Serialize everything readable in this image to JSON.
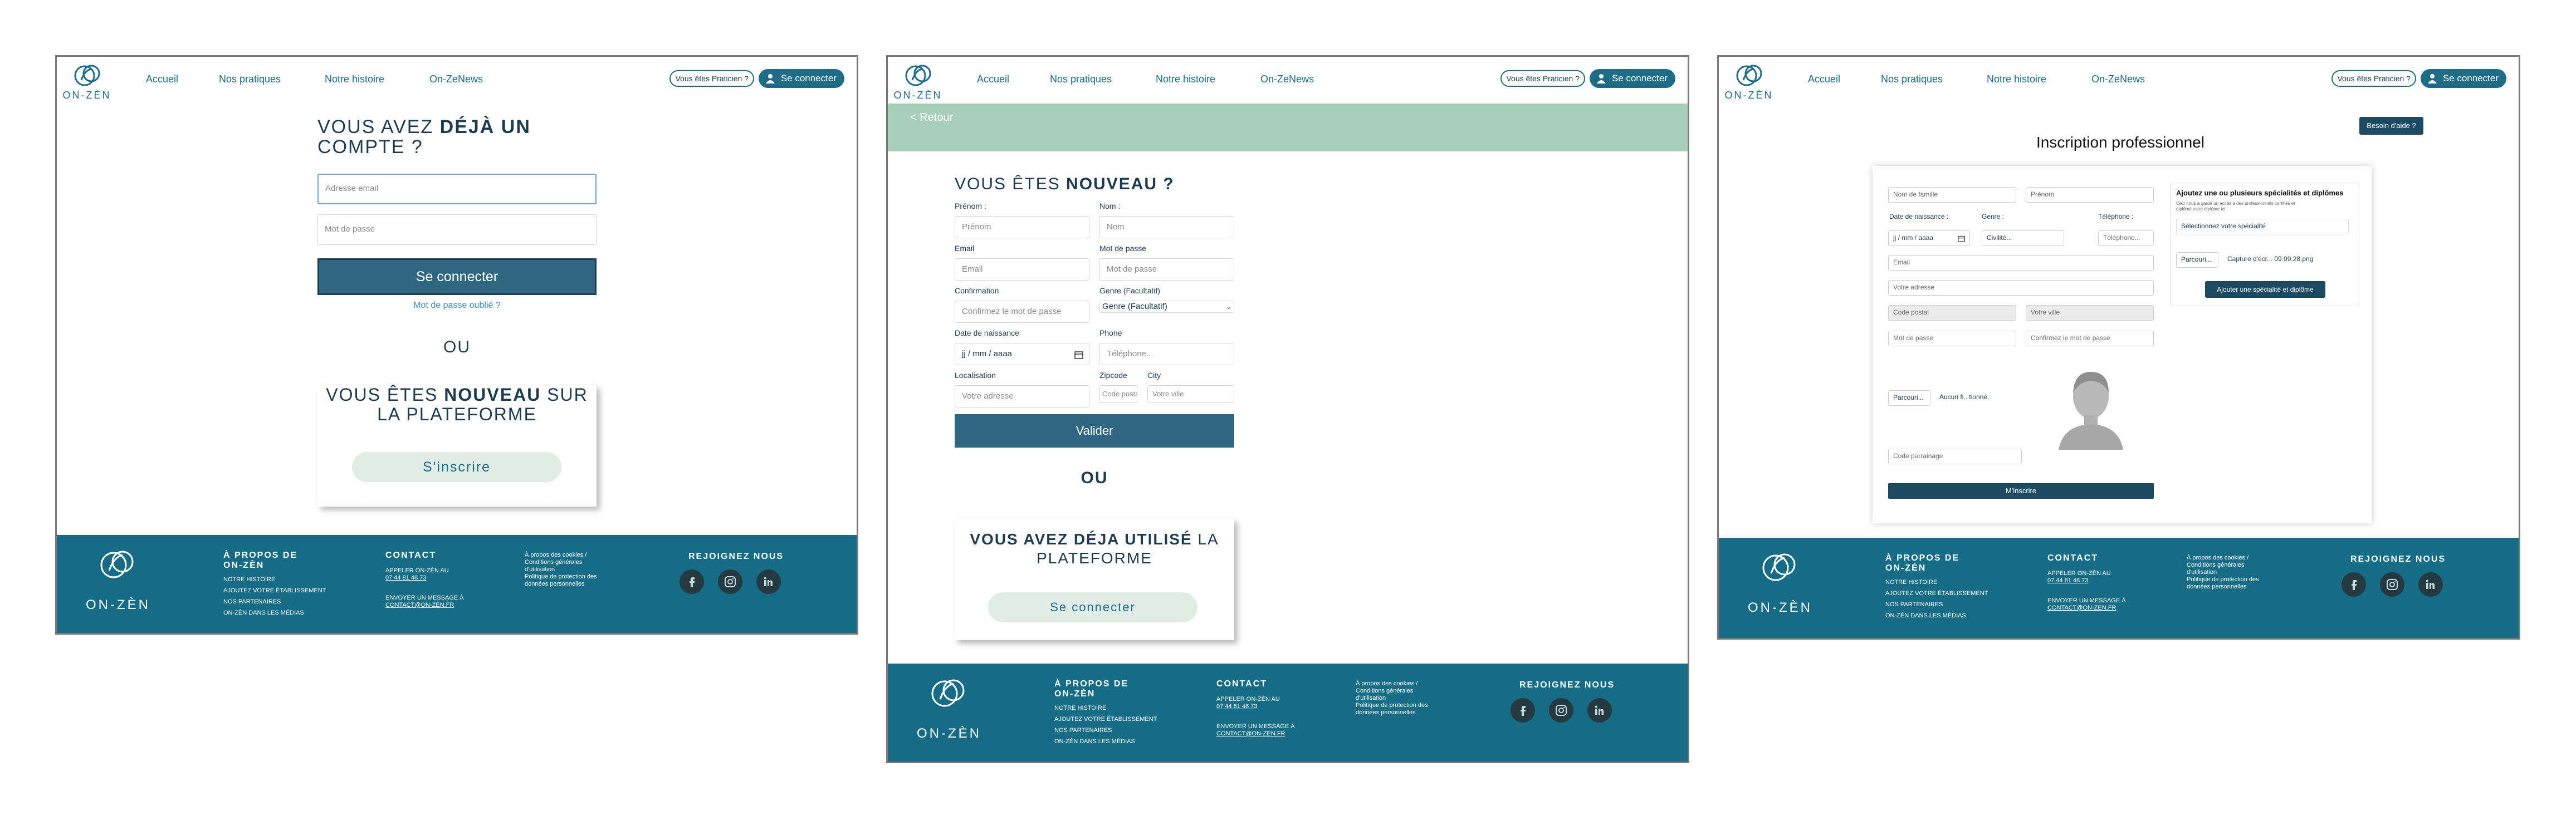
{
  "header": {
    "logo_text": "ON-ZÈN",
    "nav": [
      "Accueil",
      "Nos pratiques",
      "Notre histoire",
      "On-ZeNews"
    ],
    "pro_button": "Vous êtes Praticien ?",
    "connect_button": "Se connecter"
  },
  "login": {
    "title_part1": "VOUS AVEZ ",
    "title_bold": "DÉJÀ UN",
    "title_line2": "COMPTE ?",
    "email_placeholder": "Adresse email",
    "password_placeholder": "Mot de passe",
    "submit": "Se connecter",
    "forgot": "Mot de passe oublié ?",
    "or": "OU",
    "new_part1": "VOUS ÊTES ",
    "new_bold": "NOUVEAU",
    "new_part2": " SUR",
    "new_line2": "LA PLATEFORME",
    "register_button": "S'inscrire"
  },
  "signup": {
    "back": "< Retour",
    "title_part1": "VOUS ÊTES ",
    "title_bold": "NOUVEAU ?",
    "labels": {
      "firstname": "Prénom :",
      "lastname": "Nom :",
      "email": "Email",
      "password": "Mot de passe",
      "confirm": "Confirmation",
      "gender": "Genre (Facultatif)",
      "birth": "Date de naissance",
      "phone": "Phone",
      "location": "Localisation",
      "zipcode": "Zipcode",
      "city": "City"
    },
    "placeholders": {
      "firstname": "Prénom",
      "lastname": "Nom",
      "email": "Email",
      "password": "Mot de passe",
      "confirm": "Confirmez le mot de passe",
      "gender": "Genre (Facultatif)",
      "birth": "jj / mm / aaaa",
      "phone": "Téléphone...",
      "address": "Votre adresse",
      "zip": "Code posta",
      "city": "Votre ville"
    },
    "submit": "Valider",
    "or": "OU",
    "used_bold": "VOUS AVEZ DÉJA UTILISÉ",
    "used_part2": " LA",
    "used_line2": "PLATEFORME",
    "connect_button": "Se connecter"
  },
  "pro": {
    "help_button": "Besoin d'aide ?",
    "title": "Inscription professionnel",
    "fields": {
      "lastname": "Nom de famille",
      "firstname": "Prénom",
      "birth_label": "Date de naissance :",
      "gender_label": "Genre :",
      "phone_label": "Téléphone :",
      "birth": "jj / mm / aaaa",
      "gender": "Civilité...",
      "phone": "Téléphone...",
      "email": "Email",
      "address": "Votre adresse",
      "zip": "Code postal",
      "city": "Votre ville",
      "password": "Mot de passe",
      "confirm": "Confirmez le mot de passe",
      "course": "Parcouri...",
      "none_selected": "Aucun fi...tionné.",
      "referral": "Code parrainage",
      "submit": "M'inscrire"
    },
    "specialty": {
      "title": "Ajoutez une ou plusieurs spécialités et diplômes",
      "hint": "Ceci nous a gardé un accès à des professionnels certifiés et diplômé votre diplôme ici",
      "select": "Sélectionnez votre spécialité",
      "course": "Parcouri...",
      "file": "Capture d'écr... 09.09.28.png",
      "add_button": "Ajouter une spécialité et diplôme"
    }
  },
  "footer": {
    "logo_text": "ON-ZÈN",
    "about_title": "À PROPOS DE ON-ZÈN",
    "about_links": [
      "NOTRE HISTOIRE",
      "AJOUTEZ VOTRE ÉTABLISSEMENT",
      "NOS PARTENAIRES",
      "ON-ZÈN DANS LES MÉDIAS"
    ],
    "contact_title": "CONTACT",
    "contact_call": "APPELER ON-ZÈN AU",
    "contact_phone": "07 44 81 48 73",
    "contact_msg": "ENVOYER UN MESSAGE À",
    "contact_email": "CONTACT@ON-ZEN.FR",
    "legal": [
      "À propos des cookies /",
      "Conditions générales",
      "d'utilisation",
      "Politique de protection des",
      "données personnelles"
    ],
    "join_title": "REJOIGNEZ NOUS",
    "social_icons": [
      "facebook-icon",
      "instagram-icon",
      "linkedin-icon"
    ]
  },
  "colors": {
    "teal": "#166b85",
    "dark": "#1d3b50",
    "mint": "#a7cfb9",
    "button": "#2f6780"
  }
}
